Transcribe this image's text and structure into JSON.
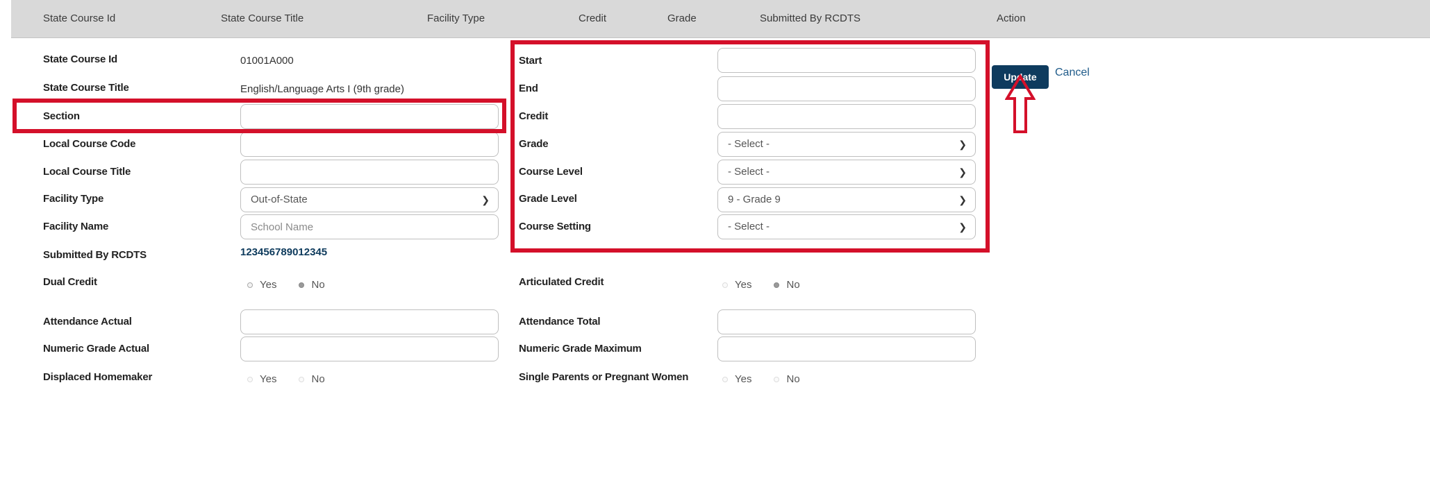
{
  "header": {
    "col_id": "State Course Id",
    "col_title": "State Course Title",
    "col_facility": "Facility Type",
    "col_credit": "Credit",
    "col_grade": "Grade",
    "col_submitted": "Submitted By RCDTS",
    "col_action": "Action"
  },
  "left": {
    "state_course_id": {
      "label": "State Course Id",
      "value": "01001A000"
    },
    "state_course_title": {
      "label": "State Course Title",
      "value": "English/Language Arts I (9th grade)"
    },
    "section": {
      "label": "Section",
      "value": ""
    },
    "local_course_code": {
      "label": "Local Course Code",
      "value": ""
    },
    "local_course_title": {
      "label": "Local Course Title",
      "value": ""
    },
    "facility_type": {
      "label": "Facility Type",
      "value": "Out-of-State"
    },
    "facility_name": {
      "label": "Facility Name",
      "placeholder": "School Name"
    },
    "submitted_by": {
      "label": "Submitted By RCDTS",
      "value": "123456789012345"
    },
    "dual_credit": {
      "label": "Dual Credit",
      "opt_yes": "Yes",
      "opt_no": "No",
      "selected": "No"
    },
    "attendance_actual": {
      "label": "Attendance Actual",
      "value": ""
    },
    "numeric_grade_actual": {
      "label": "Numeric Grade Actual",
      "value": ""
    },
    "displaced_homemaker": {
      "label": "Displaced Homemaker",
      "opt_yes": "Yes",
      "opt_no": "No"
    }
  },
  "right": {
    "start": {
      "label": "Start",
      "value": ""
    },
    "end": {
      "label": "End",
      "value": ""
    },
    "credit": {
      "label": "Credit",
      "value": ""
    },
    "grade": {
      "label": "Grade",
      "value": "- Select -"
    },
    "course_level": {
      "label": "Course Level",
      "value": "- Select -"
    },
    "grade_level": {
      "label": "Grade Level",
      "value": "9 - Grade 9"
    },
    "course_setting": {
      "label": "Course Setting",
      "value": "- Select -"
    },
    "articulated_credit": {
      "label": "Articulated Credit",
      "opt_yes": "Yes",
      "opt_no": "No",
      "selected": "No"
    },
    "attendance_total": {
      "label": "Attendance Total",
      "value": ""
    },
    "numeric_grade_maximum": {
      "label": "Numeric Grade Maximum",
      "value": ""
    },
    "single_parents": {
      "label": "Single Parents or Pregnant Women",
      "opt_yes": "Yes",
      "opt_no": "No"
    }
  },
  "actions": {
    "update": "Update",
    "cancel": "Cancel"
  },
  "colors": {
    "highlight": "#d4102a",
    "button": "#0e3b5e",
    "header_bg": "#d9d9d9"
  },
  "icons": {
    "chevron": "chevron-down-icon",
    "arrow": "up-arrow-outline-icon"
  }
}
